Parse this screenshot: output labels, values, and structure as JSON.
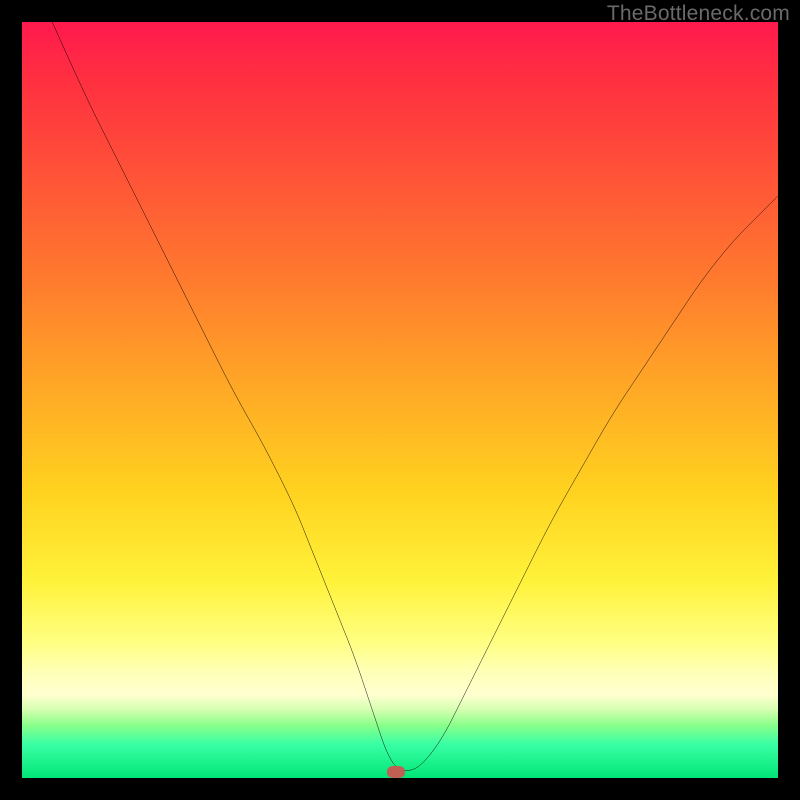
{
  "watermark": "TheBottleneck.com",
  "colors": {
    "gradient_top": "#ff1a4d",
    "gradient_mid": "#ffd21f",
    "gradient_bottom": "#00e676",
    "curve": "#000000",
    "marker": "#c06055",
    "frame": "#000000"
  },
  "chart_data": {
    "type": "line",
    "title": "",
    "xlabel": "",
    "ylabel": "",
    "xlim": [
      0,
      100
    ],
    "ylim": [
      0,
      100
    ],
    "grid": false,
    "series": [
      {
        "name": "bottleneck-curve",
        "x": [
          4,
          8,
          12,
          16,
          20,
          24,
          28,
          32,
          36,
          38,
          40,
          42,
          44,
          46,
          47,
          48,
          49,
          50,
          52,
          54,
          56,
          58,
          60,
          63,
          66,
          70,
          74,
          78,
          82,
          86,
          90,
          94,
          98,
          100
        ],
        "y": [
          100,
          91,
          83,
          75,
          67,
          59,
          51,
          44,
          36,
          31,
          26,
          21,
          16,
          10,
          7,
          4,
          2,
          1,
          1,
          3,
          6,
          10,
          14,
          20,
          26,
          34,
          41,
          48,
          54,
          60,
          66,
          71,
          75,
          77
        ]
      }
    ],
    "marker": {
      "x": 49.5,
      "y": 0.8
    },
    "annotations": []
  }
}
